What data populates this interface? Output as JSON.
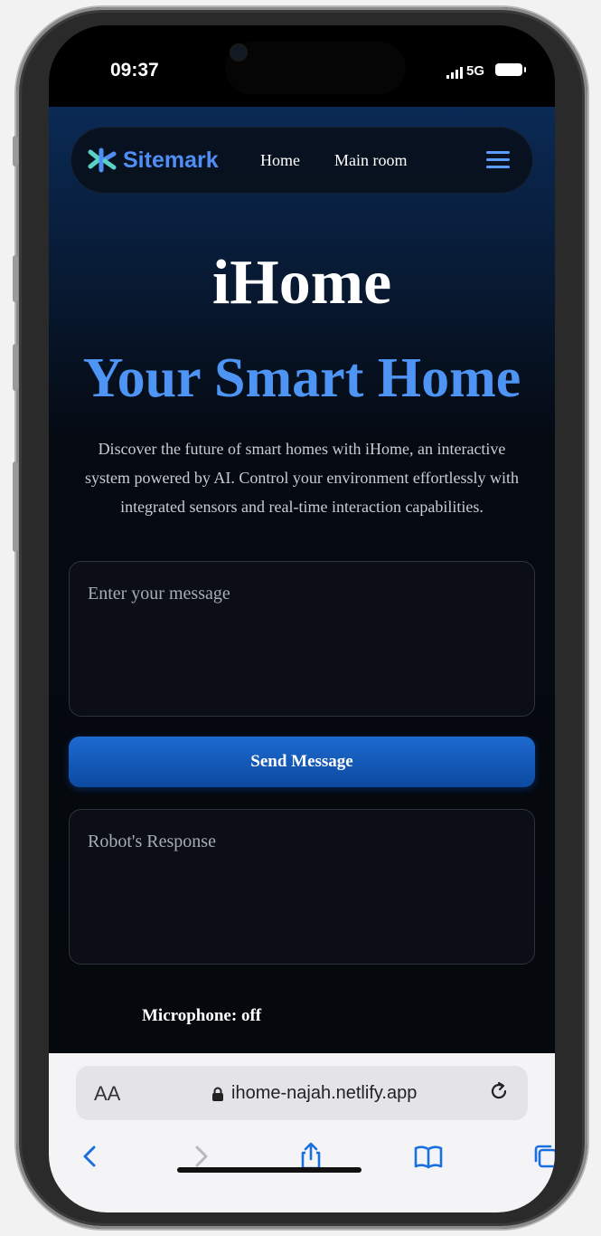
{
  "status_bar": {
    "time": "09:37",
    "network": "5G"
  },
  "nav": {
    "brand": "Sitemark",
    "links": [
      "Home",
      "Main room"
    ]
  },
  "hero": {
    "title": "iHome",
    "subtitle": "Your Smart Home",
    "description": "Discover the future of smart homes with iHome, an interactive system powered by AI. Control your environment effortlessly with integrated sensors and real-time interaction capabilities."
  },
  "chat": {
    "message_placeholder": "Enter your message",
    "send_label": "Send Message",
    "response_placeholder": "Robot's Response",
    "mic_status": "Microphone: off"
  },
  "browser": {
    "text_size_label": "AA",
    "url": "ihome-najah.netlify.app"
  },
  "colors": {
    "accent": "#4d94f4",
    "button": "#1d6ad0"
  }
}
